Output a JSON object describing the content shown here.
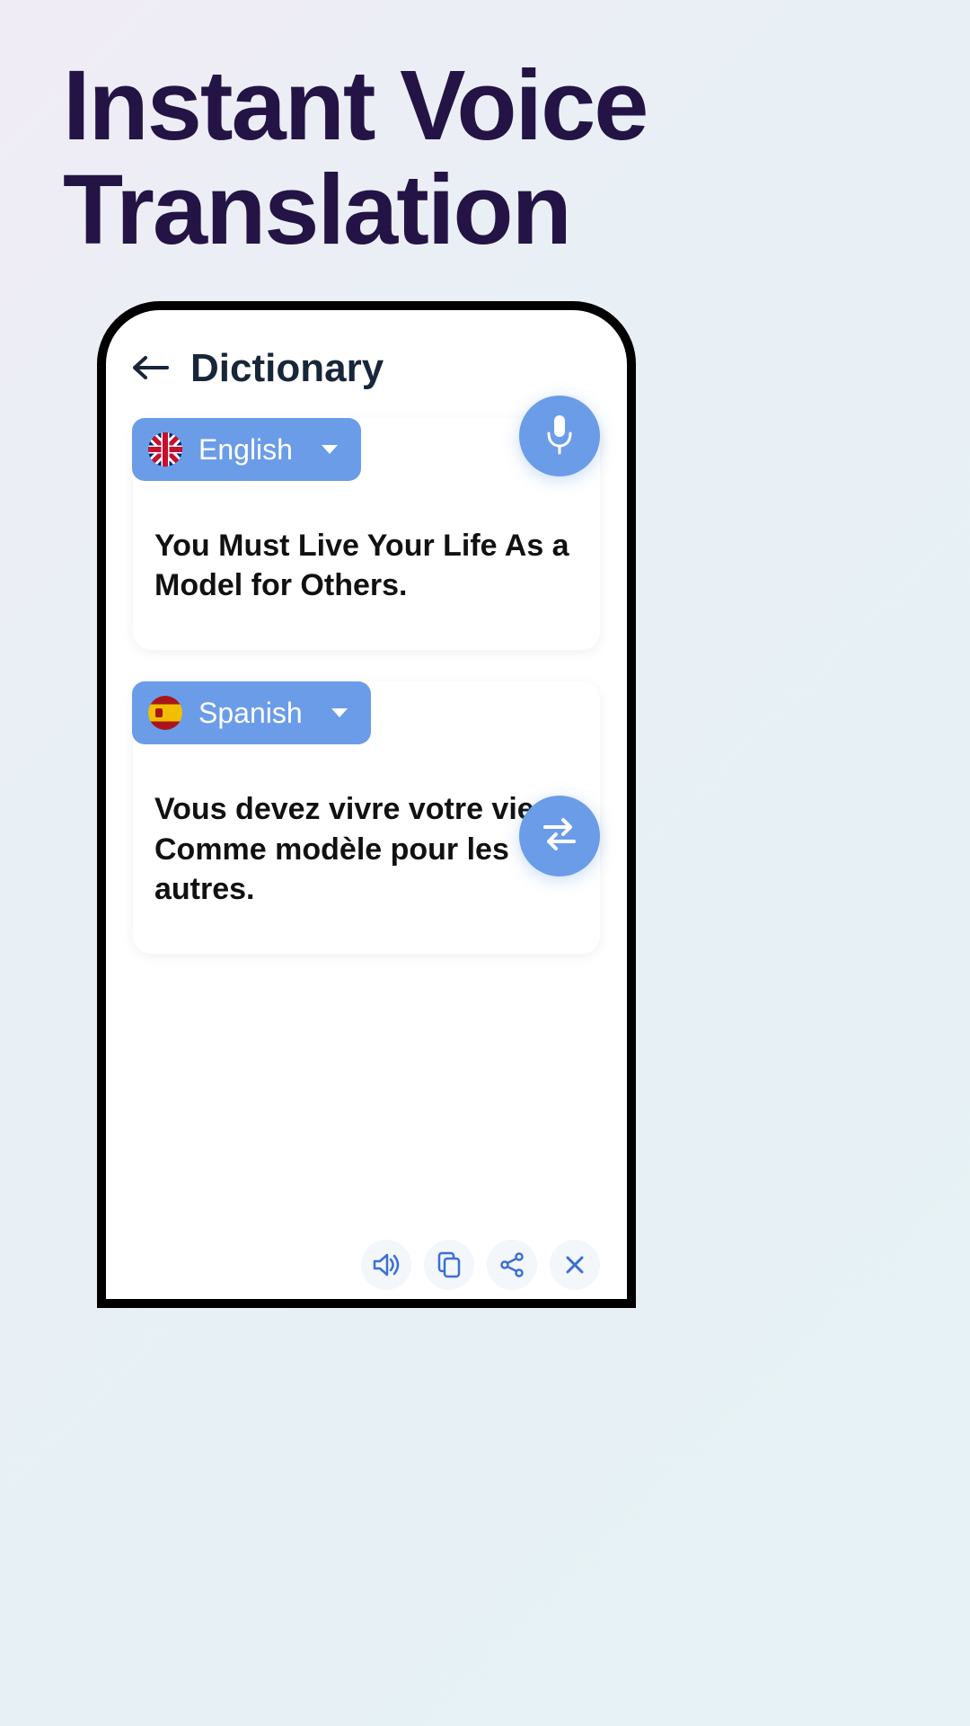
{
  "page": {
    "title_line1": "Instant Voice",
    "title_line2": "Translation"
  },
  "header": {
    "title": "Dictionary"
  },
  "source": {
    "language": "English",
    "text": "You Must Live Your Life As a Model for Others."
  },
  "target": {
    "language": "Spanish",
    "text": "Vous devez vivre votre vie Comme modèle pour les autres."
  },
  "colors": {
    "accent": "#6b9ce8",
    "heading": "#241445"
  }
}
